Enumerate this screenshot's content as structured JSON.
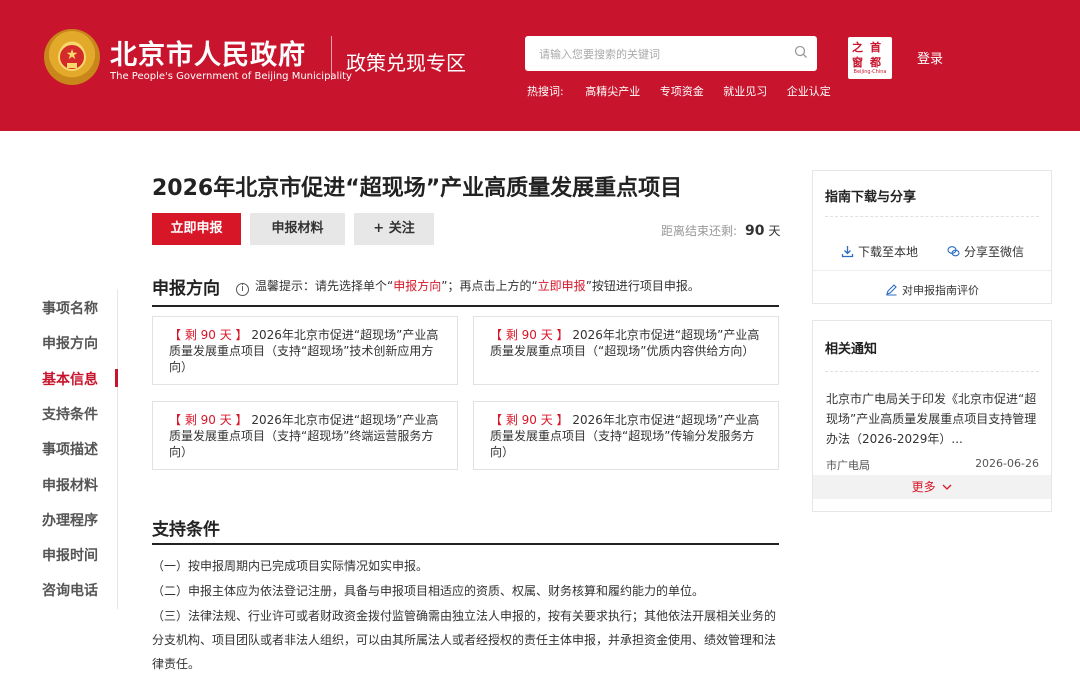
{
  "header": {
    "site_title": "北京市人民政府",
    "site_subtitle": "The People's Government of Beijing Municipality",
    "zone_title": "政策兑现专区",
    "search_placeholder": "请输入您要搜索的关键词",
    "hot_label": "热搜词:",
    "hot_keywords": [
      "高精尖产业",
      "专项资金",
      "就业见习",
      "企业认定"
    ],
    "capital_logo": {
      "c1": "之",
      "c2": "首",
      "c3": "窗",
      "c4": "都",
      "tag": "Beijing·China"
    },
    "login": "登录",
    "bg_color": "#c8152d"
  },
  "leftnav": {
    "items": [
      "事项名称",
      "申报方向",
      "基本信息",
      "支持条件",
      "事项描述",
      "申报材料",
      "办理程序",
      "申报时间",
      "咨询电话"
    ],
    "active": "基本信息"
  },
  "main": {
    "title": "2026年北京市促进“超现场”产业高质量发展重点项目",
    "buttons": {
      "apply": "立即申报",
      "material": "申报材料",
      "follow": "+ 关注"
    },
    "countdown": {
      "label": "距离结束还剩:",
      "value": "90",
      "unit": "天"
    },
    "direction": {
      "heading": "申报方向",
      "tip_icon": "i",
      "tip_1": "温馨提示：请先选择单个“",
      "tip_red_1": "申报方向",
      "tip_2": "”；再点击上方的“",
      "tip_red_2": "立即申报",
      "tip_3": "”按钮进行项目申报。",
      "cards": [
        {
          "remain": "【 剩 90 天 】",
          "text": " 2026年北京市促进“超现场”产业高质量发展重点项目（支持“超现场”技术创新应用方向）"
        },
        {
          "remain": "【 剩 90 天 】",
          "text": " 2026年北京市促进“超现场”产业高质量发展重点项目（“超现场”优质内容供给方向）"
        },
        {
          "remain": "【 剩 90 天 】",
          "text": " 2026年北京市促进“超现场”产业高质量发展重点项目（支持“超现场”终端运营服务方向）"
        },
        {
          "remain": "【 剩 90 天 】",
          "text": " 2026年北京市促进“超现场”产业高质量发展重点项目（支持“超现场”传输分发服务方向）"
        }
      ]
    },
    "conditions": {
      "heading": "支持条件",
      "items": [
        "（一）按申报周期内已完成项目实际情况如实申报。",
        "（二）申报主体应为依法登记注册，具备与申报项目相适应的资质、权属、财务核算和履约能力的单位。",
        "（三）法律法规、行业许可或者财政资金拨付监管确需由独立法人申报的，按有关要求执行；其他依法开展相关业务的分支机构、项目团队或者非法人组织，可以由其所属法人或者经授权的责任主体申报，并承担资金使用、绩效管理和法律责任。"
      ]
    }
  },
  "right": {
    "guide": {
      "title": "指南下载与分享",
      "download": "下载至本地",
      "share": "分享至微信",
      "rate": "对申报指南评价"
    },
    "notice": {
      "title": "相关通知",
      "text": "北京市广电局关于印发《北京市促进“超现场”产业高质量发展重点项目支持管理办法（2026-2029年）...",
      "source": "市广电局",
      "date": "2026-06-26",
      "more": "更多"
    }
  }
}
